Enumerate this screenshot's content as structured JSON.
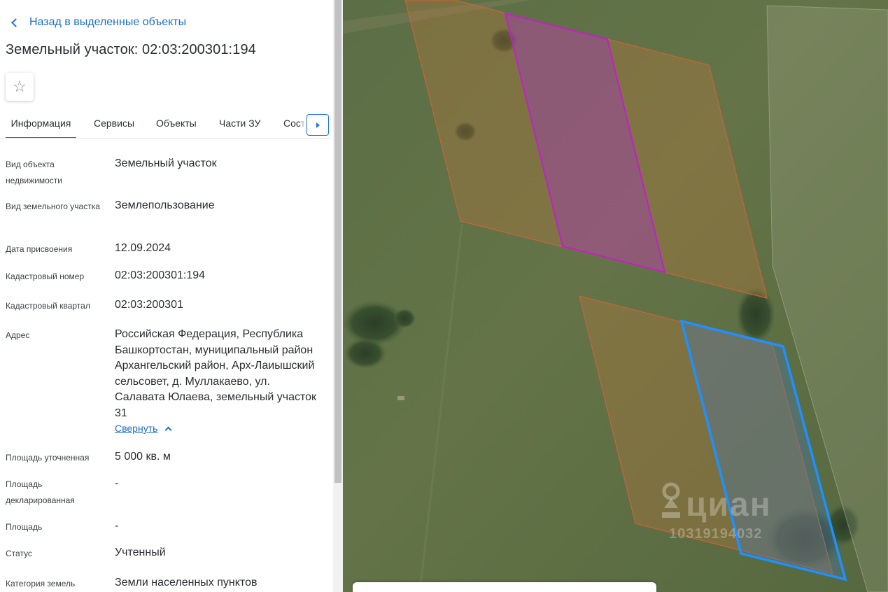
{
  "header": {
    "back_label": "Назад в выделенные объекты",
    "title": "Земельный участок: 02:03:200301:194",
    "favorite_icon": "☆"
  },
  "tabs": [
    {
      "label": "Информация",
      "active": true
    },
    {
      "label": "Сервисы",
      "active": false
    },
    {
      "label": "Объекты",
      "active": false
    },
    {
      "label": "Части ЗУ",
      "active": false
    },
    {
      "label": "Состав",
      "active": false
    }
  ],
  "info": [
    {
      "label": "Вид объекта недвижимости",
      "value": "Земельный участок"
    },
    {
      "label": "Вид земельного участка",
      "value": "Землепользование"
    },
    {
      "label": "Дата присвоения",
      "value": "12.09.2024"
    },
    {
      "label": "Кадастровый номер",
      "value": "02:03:200301:194"
    },
    {
      "label": "Кадастровый квартал",
      "value": "02:03:200301"
    },
    {
      "label": "Адрес",
      "value": "Российская Федерация, Республика Башкортостан, муниципальный район Архангельский район, Арх-Лаиышский сельсовет, д. Муллакаево, ул. Салавата Юлаева, земельный участок 31"
    },
    {
      "label": "Площадь уточненная",
      "value": "5 000 кв. м"
    },
    {
      "label": "Площадь декларированная",
      "value": "-"
    },
    {
      "label": "Площадь",
      "value": "-"
    },
    {
      "label": "Статус",
      "value": "Учтенный"
    },
    {
      "label": "Категория земель",
      "value": "Земли населенных пунктов"
    }
  ],
  "collapse_label": "Свернуть",
  "map": {
    "watermark_text": "циан",
    "watermark_number": "10319194032",
    "colors": {
      "parcel_outline": "#c8643a",
      "parcel_fill": "#c8783c",
      "magenta_outline": "#c020c8",
      "magenta_fill": "#a03cb4",
      "selected_outline": "#1e90ff",
      "selected_fill": "#4678b4",
      "link": "#1e6fc8"
    }
  }
}
